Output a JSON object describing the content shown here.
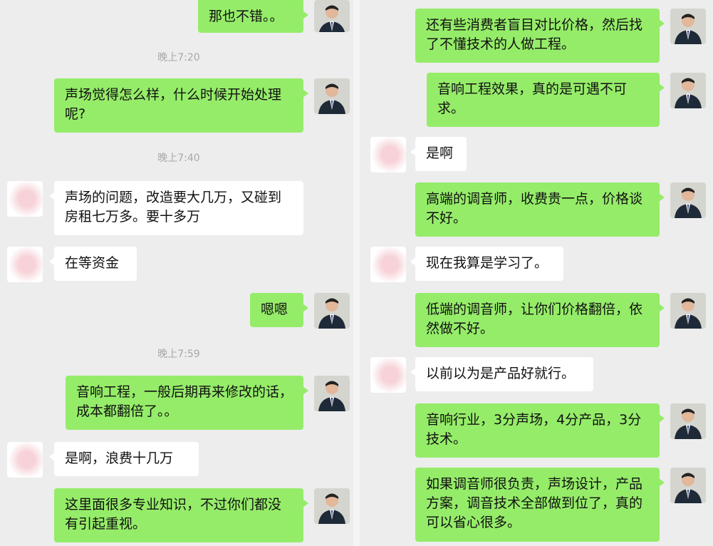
{
  "left": {
    "messages": [
      {
        "from": "me",
        "text": "那也不错。。"
      },
      {
        "time": "晚上7:20"
      },
      {
        "from": "me",
        "text": "声场觉得怎么样，什么时候开始处理呢?"
      },
      {
        "time": "晚上7:40"
      },
      {
        "from": "other",
        "text": "声场的问题，改造要大几万，又碰到房租七万多。要十多万"
      },
      {
        "from": "other",
        "text": "在等资金"
      },
      {
        "from": "me",
        "text": "嗯嗯"
      },
      {
        "time": "晚上7:59"
      },
      {
        "from": "me",
        "text": "音响工程，一般后期再来修改的话，成本都翻倍了。。"
      },
      {
        "from": "other",
        "text": "是啊，浪费十几万"
      },
      {
        "from": "me",
        "text": "这里面很多专业知识，不过你们都没有引起重视。"
      }
    ]
  },
  "right": {
    "messages": [
      {
        "from": "me",
        "text": "还有些消费者盲目对比价格，然后找了不懂技术的人做工程。"
      },
      {
        "from": "me",
        "text": "音响工程效果，真的是可遇不可求。"
      },
      {
        "from": "other",
        "text": "是啊"
      },
      {
        "from": "me",
        "text": "高端的调音师，收费贵一点，价格谈不好。"
      },
      {
        "from": "other",
        "text": "现在我算是学习了。"
      },
      {
        "from": "me",
        "text": "低端的调音师，让你们价格翻倍，依然做不好。"
      },
      {
        "from": "other",
        "text": "以前以为是产品好就行。"
      },
      {
        "from": "me",
        "text": "音响行业，3分声场，4分产品，3分技术。"
      },
      {
        "from": "me",
        "text": "如果调音师很负责，声场设计，产品方案，调音技术全部做到位了，真的可以省心很多。"
      }
    ]
  }
}
